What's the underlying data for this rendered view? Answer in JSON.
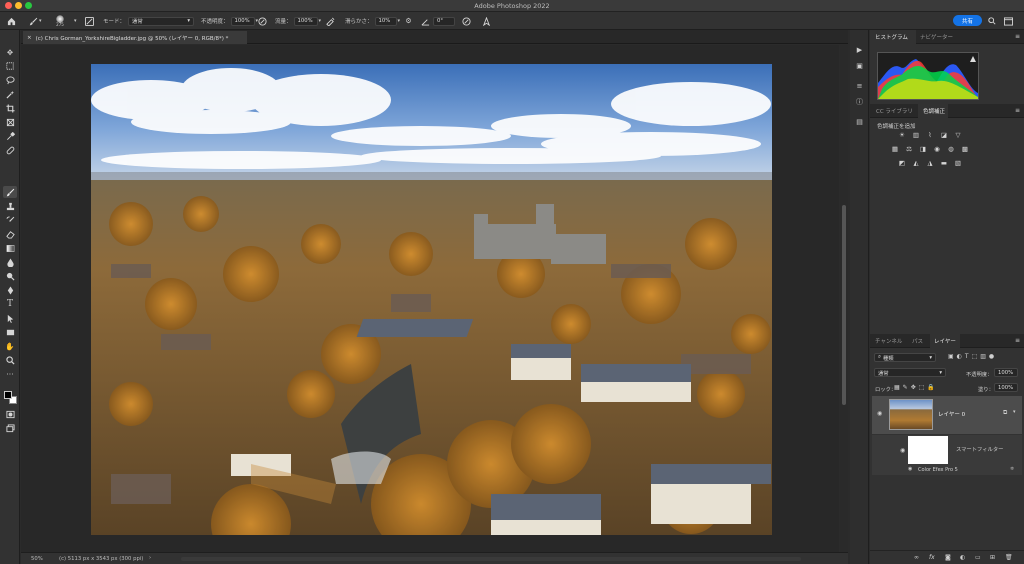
{
  "window": {
    "title": "Adobe Photoshop 2022"
  },
  "options_bar": {
    "brush_size": "275",
    "mode_label": "モード：",
    "mode_value": "通常",
    "opacity_label": "不透明度：",
    "opacity_value": "100%",
    "flow_label": "流量：",
    "flow_value": "100%",
    "smoothing_label": "滑らかさ：",
    "smoothing_value": "10%",
    "angle_value": "0°",
    "share_label": "共有"
  },
  "document": {
    "tab_title": "(c) Chris Gorman_YorkshireBigladder.jpg @ 50% (レイヤー 0, RGB/8*) *",
    "zoom": "50%",
    "doc_info": "(c) 5113 px x 3543 px (300 ppi)"
  },
  "panels": {
    "histogram_tab": "ヒストグラム",
    "navigator_tab": "ナビゲーター",
    "libraries_tab": "CC ライブラリ",
    "adjustments_tab": "色調補正",
    "add_adjustment": "色調補正を追加",
    "channels_tab": "チャンネル",
    "paths_tab": "パス",
    "layers_tab": "レイヤー"
  },
  "layers": {
    "filter_kind": "種類",
    "blend_mode": "通常",
    "opacity_label": "不透明度：",
    "opacity_value": "100%",
    "lock_label": "ロック：",
    "fill_label": "塗り：",
    "fill_value": "100%",
    "layer_name": "レイヤー 0",
    "smart_filter_label": "スマートフィルター",
    "filter_name": "Color Efex Pro 5"
  },
  "colors": {
    "accent": "#1473e6",
    "panel_bg": "#323232",
    "canvas_bg": "#282828"
  }
}
